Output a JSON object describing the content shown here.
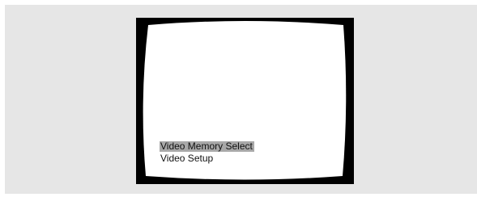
{
  "colors": {
    "background": "#e6e6e6",
    "bezel": "#000000",
    "screen": "#ffffff",
    "highlight": "#a8a8a8"
  },
  "menu": {
    "items": [
      {
        "label": "Video Memory Select",
        "selected": true
      },
      {
        "label": "Video Setup",
        "selected": false
      }
    ]
  }
}
